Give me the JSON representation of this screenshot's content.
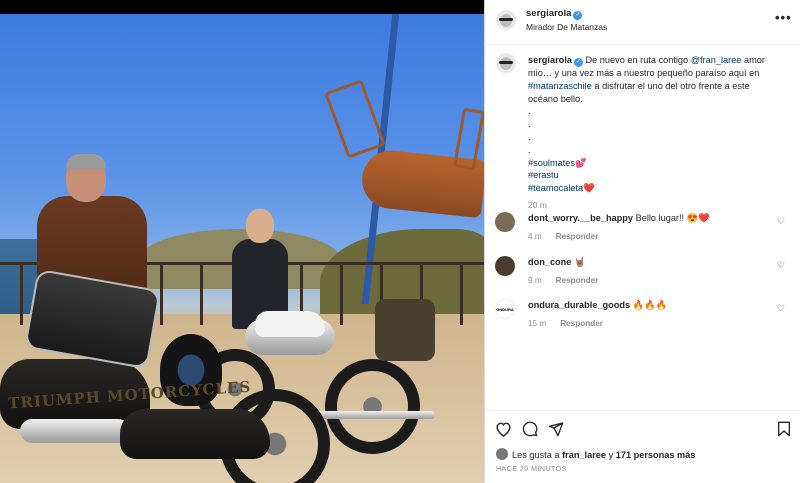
{
  "post": {
    "photo_brand_text": "TRIUMPH MOTORCYCLES"
  },
  "header": {
    "username": "sergiarola",
    "location": "Mirador De Matanzas",
    "more_icon": "more-horizontal-icon"
  },
  "caption": {
    "username": "sergiarola",
    "text_1": "De nuevo en ruta contigo",
    "mention": "@fran_laree",
    "text_2": "amor mio… y una vez más a nuestro pequeño paraíso aquí en",
    "hashtag_1": "#matanzaschile",
    "text_3": "a disfrutar el uno del otro frente a este océano bello.",
    "dots": [
      ".",
      ".",
      ".",
      "."
    ],
    "hashtags": [
      "#soulmates💕",
      "#erastu",
      "#teamocaleta❤️"
    ],
    "time": "20 m"
  },
  "comments": [
    {
      "username": "dont_worry.__be_happy",
      "text": "Bello lugar!! 😍❤️",
      "time": "4 m",
      "reply": "Responder",
      "avatar_color": "#7a6a58"
    },
    {
      "username": "don_cone",
      "text": "🤘🏽",
      "time": "9 m",
      "reply": "Responder",
      "avatar_color": "#4b3b2d"
    },
    {
      "username": "ondura_durable_goods",
      "text": "🔥🔥🔥",
      "time": "15 m",
      "reply": "Responder",
      "avatar_color": "#ffffff",
      "avatar_text": "ONDURA"
    }
  ],
  "actions": {
    "like_icon": "heart-icon",
    "comment_icon": "comment-icon",
    "share_icon": "send-icon",
    "save_icon": "bookmark-icon"
  },
  "likes": {
    "prefix": "Les gusta a",
    "user": "fran_laree",
    "middle": "y",
    "others": "171 personas más"
  },
  "timestamp": "HACE 20 MINUTOS",
  "colors": {
    "link": "#00376b",
    "verified": "#3897f0",
    "muted": "#8e8e8e"
  }
}
